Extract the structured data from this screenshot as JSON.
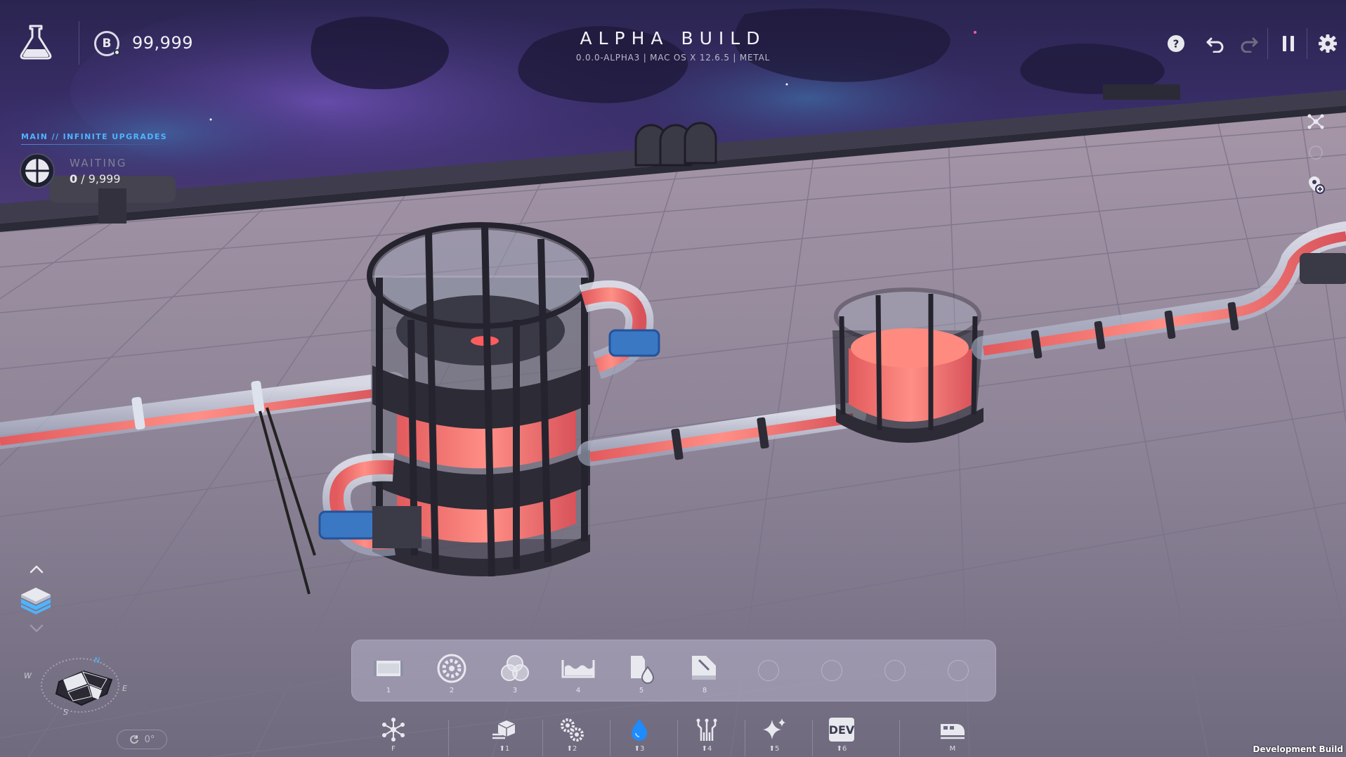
{
  "hud": {
    "currency_value": "99,999",
    "currency_symbol": "B",
    "title": "ALPHA BUILD",
    "subtitle": "0.0.0-ALPHA3 | MAC OS X 12.6.5 | METAL"
  },
  "upgrades": {
    "heading": "MAIN // INFINITE UPGRADES",
    "status": "WAITING",
    "progress_current": "0",
    "progress_separator": " / ",
    "progress_total": "9,999"
  },
  "toolbar": {
    "slots": [
      {
        "key": "1",
        "icon": "belt-icon"
      },
      {
        "key": "2",
        "icon": "gear-cog-icon"
      },
      {
        "key": "3",
        "icon": "color-mixer-icon"
      },
      {
        "key": "4",
        "icon": "fluid-tank-icon"
      },
      {
        "key": "5",
        "icon": "fluid-pump-icon"
      },
      {
        "key": "8",
        "icon": "painter-icon"
      }
    ],
    "empty_slots": 4
  },
  "layerbar": {
    "items": [
      {
        "key": "F",
        "icon": "star-network-icon"
      },
      {
        "key": "⬆1",
        "icon": "cube-layer-icon"
      },
      {
        "key": "⬆2",
        "icon": "gears-layer-icon"
      },
      {
        "key": "⬆3",
        "icon": "water-drop-icon"
      },
      {
        "key": "⬆4",
        "icon": "signals-layer-icon"
      },
      {
        "key": "⬆5",
        "icon": "sparkle-icon"
      },
      {
        "key": "⬆6",
        "label": "DEV"
      },
      {
        "key": "M",
        "icon": "train-icon"
      }
    ]
  },
  "compass": {
    "n": "N",
    "e": "E",
    "s": "S",
    "w": "W"
  },
  "rotation": "0°",
  "footer": "Development Build",
  "colors": {
    "accent": "#4fb4ff",
    "fluid": "#f0706e",
    "pipe_glass": "#c8cfe0",
    "floor": "#9a8fa3"
  }
}
